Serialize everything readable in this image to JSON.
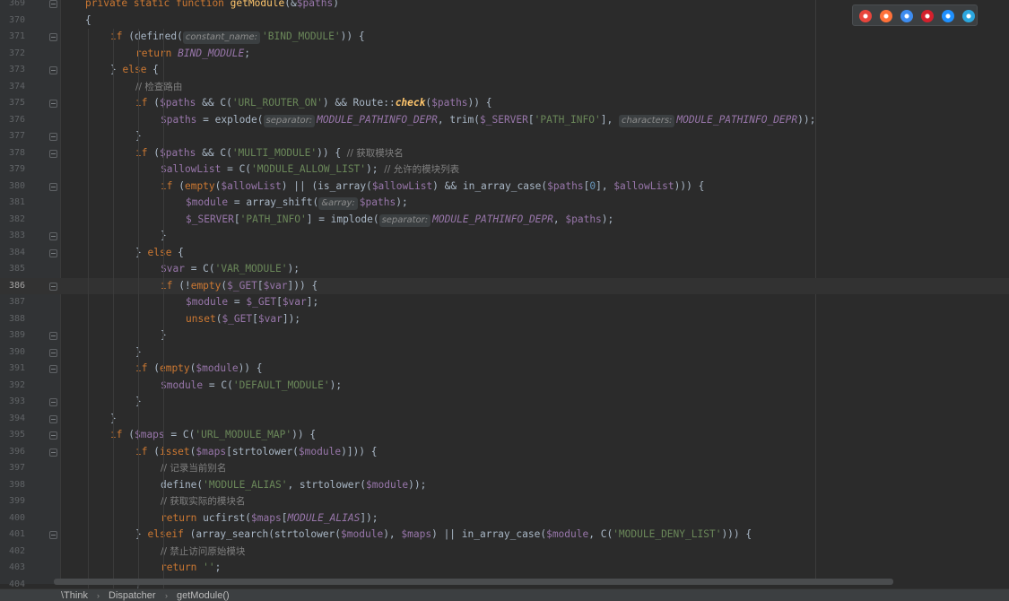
{
  "editor": {
    "current_line": "386",
    "lines": [
      {
        "n": "369",
        "indent": 0,
        "html": "<span class='kw'>private static function </span><span class='fn'>getModule</span>(&amp;<span class='var'>$paths</span>)"
      },
      {
        "n": "370",
        "indent": 0,
        "html": "{"
      },
      {
        "n": "371",
        "indent": 1,
        "html": "<span class='kw'>if </span>(defined(<span class='hint'>constant_name:</span><span class='str'>'BIND_MODULE'</span>)) {"
      },
      {
        "n": "372",
        "indent": 2,
        "html": "<span class='kw'>return </span><span class='const'>BIND_MODULE</span>;"
      },
      {
        "n": "373",
        "indent": 1,
        "html": "} <span class='kw'>else </span>{"
      },
      {
        "n": "374",
        "indent": 2,
        "html": "<span class='cm'>// 检查路由</span>"
      },
      {
        "n": "375",
        "indent": 2,
        "html": "<span class='kw'>if </span>(<span class='var'>$paths</span> &amp;&amp; C(<span class='str'>'URL_ROUTER_ON'</span>) &amp;&amp; Route::<span class='sfn'>check</span>(<span class='var'>$paths</span>)) {"
      },
      {
        "n": "376",
        "indent": 3,
        "html": "<span class='var'>$paths</span> = explode(<span class='hint'>separator:</span><span class='const'>MODULE_PATHINFO_DEPR</span>, trim(<span class='var'>$_SERVER</span>[<span class='str'>'PATH_INFO'</span>], <span class='hint'>characters:</span><span class='const'>MODULE_PATHINFO_DEPR</span>));"
      },
      {
        "n": "377",
        "indent": 2,
        "html": "}"
      },
      {
        "n": "378",
        "indent": 2,
        "html": "<span class='kw'>if </span>(<span class='var'>$paths</span> &amp;&amp; C(<span class='str'>'MULTI_MODULE'</span>)) { <span class='cm'>// 获取模块名</span>"
      },
      {
        "n": "379",
        "indent": 3,
        "html": "<span class='var'>$allowList</span> = C(<span class='str'>'MODULE_ALLOW_LIST'</span>); <span class='cm'>// 允许的模块列表</span>"
      },
      {
        "n": "380",
        "indent": 3,
        "html": "<span class='kw'>if </span>(<span class='kw'>empty</span>(<span class='var'>$allowList</span>) || (is_array(<span class='var'>$allowList</span>) &amp;&amp; in_array_case(<span class='var'>$paths</span>[<span class='num'>0</span>], <span class='var'>$allowList</span>))) {"
      },
      {
        "n": "381",
        "indent": 4,
        "html": "<span class='var'>$module</span> = array_shift(<span class='hint'>&amp;array:</span><span class='var'>$paths</span>);"
      },
      {
        "n": "382",
        "indent": 4,
        "html": "<span class='var'>$_SERVER</span>[<span class='str'>'PATH_INFO'</span>] = implode(<span class='hint'>separator:</span><span class='const'>MODULE_PATHINFO_DEPR</span>, <span class='var'>$paths</span>);"
      },
      {
        "n": "383",
        "indent": 3,
        "html": "}"
      },
      {
        "n": "384",
        "indent": 2,
        "html": "} <span class='kw'>else </span>{"
      },
      {
        "n": "385",
        "indent": 3,
        "html": "<span class='var'>$var</span> = C(<span class='str'>'VAR_MODULE'</span>);"
      },
      {
        "n": "386",
        "indent": 3,
        "html": "<span class='kw'>if </span>(!<span class='kw'>empty</span>(<span class='var'>$_GET</span>[<span class='var'>$var</span>])) {"
      },
      {
        "n": "387",
        "indent": 4,
        "html": "<span class='var'>$module</span> = <span class='var'>$_GET</span>[<span class='var'>$var</span>];"
      },
      {
        "n": "388",
        "indent": 4,
        "html": "<span class='kw'>unset</span>(<span class='var'>$_GET</span>[<span class='var'>$var</span>]);"
      },
      {
        "n": "389",
        "indent": 3,
        "html": "}"
      },
      {
        "n": "390",
        "indent": 2,
        "html": "}"
      },
      {
        "n": "391",
        "indent": 2,
        "html": "<span class='kw'>if </span>(<span class='kw'>empty</span>(<span class='var'>$module</span>)) {"
      },
      {
        "n": "392",
        "indent": 3,
        "html": "<span class='var'>$module</span> = C(<span class='str'>'DEFAULT_MODULE'</span>);"
      },
      {
        "n": "393",
        "indent": 2,
        "html": "}"
      },
      {
        "n": "394",
        "indent": 1,
        "html": "}"
      },
      {
        "n": "395",
        "indent": 1,
        "html": "<span class='kw'>if </span>(<span class='var'>$maps</span> = C(<span class='str'>'URL_MODULE_MAP'</span>)) {"
      },
      {
        "n": "396",
        "indent": 2,
        "html": "<span class='kw'>if </span>(<span class='kw'>isset</span>(<span class='var'>$maps</span>[strtolower(<span class='var'>$module</span>)])) {"
      },
      {
        "n": "397",
        "indent": 3,
        "html": "<span class='cm'>// 记录当前别名</span>"
      },
      {
        "n": "398",
        "indent": 3,
        "html": "define(<span class='str'>'MODULE_ALIAS'</span>, strtolower(<span class='var'>$module</span>));"
      },
      {
        "n": "399",
        "indent": 3,
        "html": "<span class='cm'>// 获取实际的模块名</span>"
      },
      {
        "n": "400",
        "indent": 3,
        "html": "<span class='kw'>return </span>ucfirst(<span class='var'>$maps</span>[<span class='const'>MODULE_ALIAS</span>]);"
      },
      {
        "n": "401",
        "indent": 2,
        "html": "} <span class='kw'>elseif </span>(array_search(strtolower(<span class='var'>$module</span>), <span class='var'>$maps</span>) || in_array_case(<span class='var'>$module</span>, C(<span class='str'>'MODULE_DENY_LIST'</span>))) {"
      },
      {
        "n": "402",
        "indent": 3,
        "html": "<span class='cm'>// 禁止访问原始模块</span>"
      },
      {
        "n": "403",
        "indent": 3,
        "html": "<span class='kw'>return </span><span class='str'>''</span>;"
      },
      {
        "n": "404",
        "indent": 2,
        "html": "}"
      }
    ],
    "folds": [
      "369",
      "371",
      "373",
      "375",
      "377",
      "378",
      "380",
      "383",
      "384",
      "386",
      "389",
      "390",
      "391",
      "393",
      "394",
      "395",
      "396",
      "401"
    ]
  },
  "breadcrumb": {
    "items": [
      "\\Think",
      "Dispatcher",
      "getModule()"
    ],
    "separator": "›"
  },
  "browser_icons": [
    {
      "name": "chrome-icon",
      "color": "#e8453c"
    },
    {
      "name": "firefox-icon",
      "color": "#ff7139"
    },
    {
      "name": "safari-icon",
      "color": "#3d8cf0"
    },
    {
      "name": "opera-icon",
      "color": "#d4202c"
    },
    {
      "name": "ie-icon",
      "color": "#1e90ff"
    },
    {
      "name": "edge-icon",
      "color": "#2ba6de"
    }
  ]
}
